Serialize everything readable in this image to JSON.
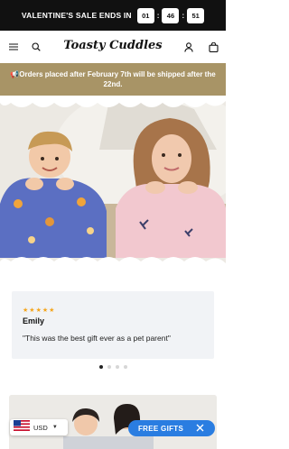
{
  "promo": {
    "label": "VALENTINE'S SALE ENDS IN",
    "hours": "01",
    "minutes": "46",
    "seconds": "51",
    "separator": ":"
  },
  "header": {
    "logo": "Toasty Cuddles",
    "icons": [
      "menu-icon",
      "search-icon",
      "account-icon",
      "bag-icon"
    ]
  },
  "shipping": {
    "icon": "megaphone-icon",
    "text": "Orders placed after February 7th will be shipped after the 22nd."
  },
  "review": {
    "stars": 5,
    "star_glyph": "★",
    "name": "Emily",
    "text": "\"This was the best gift ever as a pet parent\""
  },
  "carousel": {
    "count": 4,
    "active": 1
  },
  "currency": {
    "code": "USD",
    "flag": "us-flag-icon"
  },
  "gifts": {
    "label": "FREE GIFTS"
  },
  "colors": {
    "topbar": "#111111",
    "shipbar": "#a89466",
    "gifts_button": "#2a7de1",
    "star": "#f4a51c",
    "review_bg": "#f1f3f6"
  }
}
